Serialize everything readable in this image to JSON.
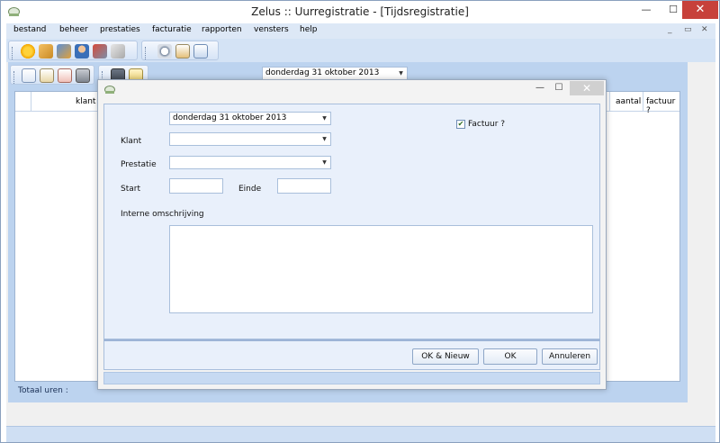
{
  "window": {
    "title": "Zelus :: Uurregistratie - [Tijdsregistratie]",
    "min_glyph": "—",
    "max_glyph": "☐",
    "close_glyph": "✕"
  },
  "menu": {
    "items": [
      "bestand",
      "beheer",
      "prestaties",
      "facturatie",
      "rapporten",
      "vensters",
      "help"
    ],
    "mdi_min": "_",
    "mdi_restore": "▭",
    "mdi_close": "✕"
  },
  "child": {
    "date_value": "donderdag 31 oktober 2013",
    "grid": {
      "columns": [
        "klant",
        "aantal",
        "factuur ?"
      ]
    },
    "totaal_label": "Totaal uren :"
  },
  "dialog": {
    "min_glyph": "—",
    "max_glyph": "☐",
    "close_glyph": "✕",
    "date_value": "donderdag 31 oktober 2013",
    "factuur_label": "Factuur ?",
    "factuur_checked": true,
    "klant_label": "Klant",
    "klant_value": "",
    "prestatie_label": "Prestatie",
    "prestatie_value": "",
    "start_label": "Start",
    "start_value": "",
    "einde_label": "Einde",
    "einde_value": "",
    "omschrijving_label": "Interne omschrijving",
    "omschrijving_value": "",
    "buttons": {
      "ok_nieuw": "OK & Nieuw",
      "ok": "OK",
      "annuleren": "Annuleren"
    }
  },
  "colors": {
    "accent": "#d4e3f5",
    "close_red": "#c7413b",
    "panel": "#e9f0fb"
  },
  "icons": {
    "app": "app-icon",
    "toolbar_main": [
      "sun-icon",
      "edit-icon",
      "users-icon",
      "user-icon",
      "tools-icon",
      "package-icon",
      "clock-icon",
      "report-icon",
      "document-icon"
    ],
    "toolbar_child": [
      "add-entry-icon",
      "edit-entry-icon",
      "delete-entry-icon",
      "print-icon",
      "calendar-icon",
      "notes-icon"
    ]
  }
}
